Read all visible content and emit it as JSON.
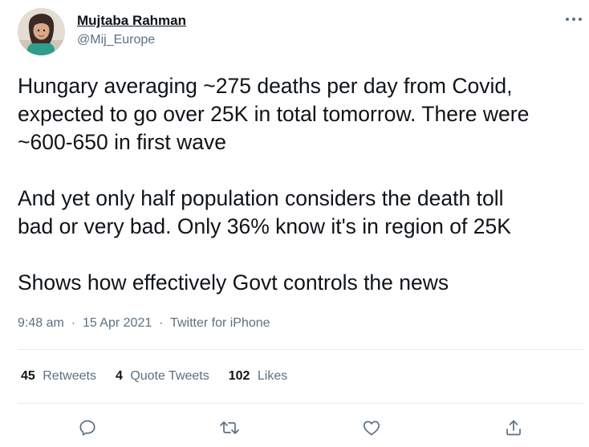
{
  "author": {
    "name": "Mujtaba Rahman",
    "handle": "@Mij_Europe"
  },
  "tweet": {
    "paragraphs": [
      [
        "Hungary averaging ~275 deaths per day from Covid,",
        "expected to go over 25K in total tomorrow. There were",
        "~600-650 in first wave"
      ],
      [
        "And yet only half population considers the death toll",
        "bad or very bad. Only 36% know it's in region of 25K"
      ],
      [
        "Shows how effectively Govt controls the news"
      ]
    ],
    "time": "9:48 am",
    "date": "15 Apr 2021",
    "source": "Twitter for iPhone",
    "separator": "·"
  },
  "stats": {
    "retweets_count": "45",
    "retweets_label": "Retweets",
    "quotes_count": "4",
    "quotes_label": "Quote Tweets",
    "likes_count": "102",
    "likes_label": "Likes"
  },
  "icons": {
    "more": "more-horizontal-icon",
    "reply": "reply-icon",
    "retweet": "retweet-icon",
    "like": "like-icon",
    "share": "share-icon"
  },
  "colors": {
    "text": "#0f1419",
    "secondary": "#5b7083",
    "divider": "#e6ecf0",
    "icon": "#5b7083"
  }
}
